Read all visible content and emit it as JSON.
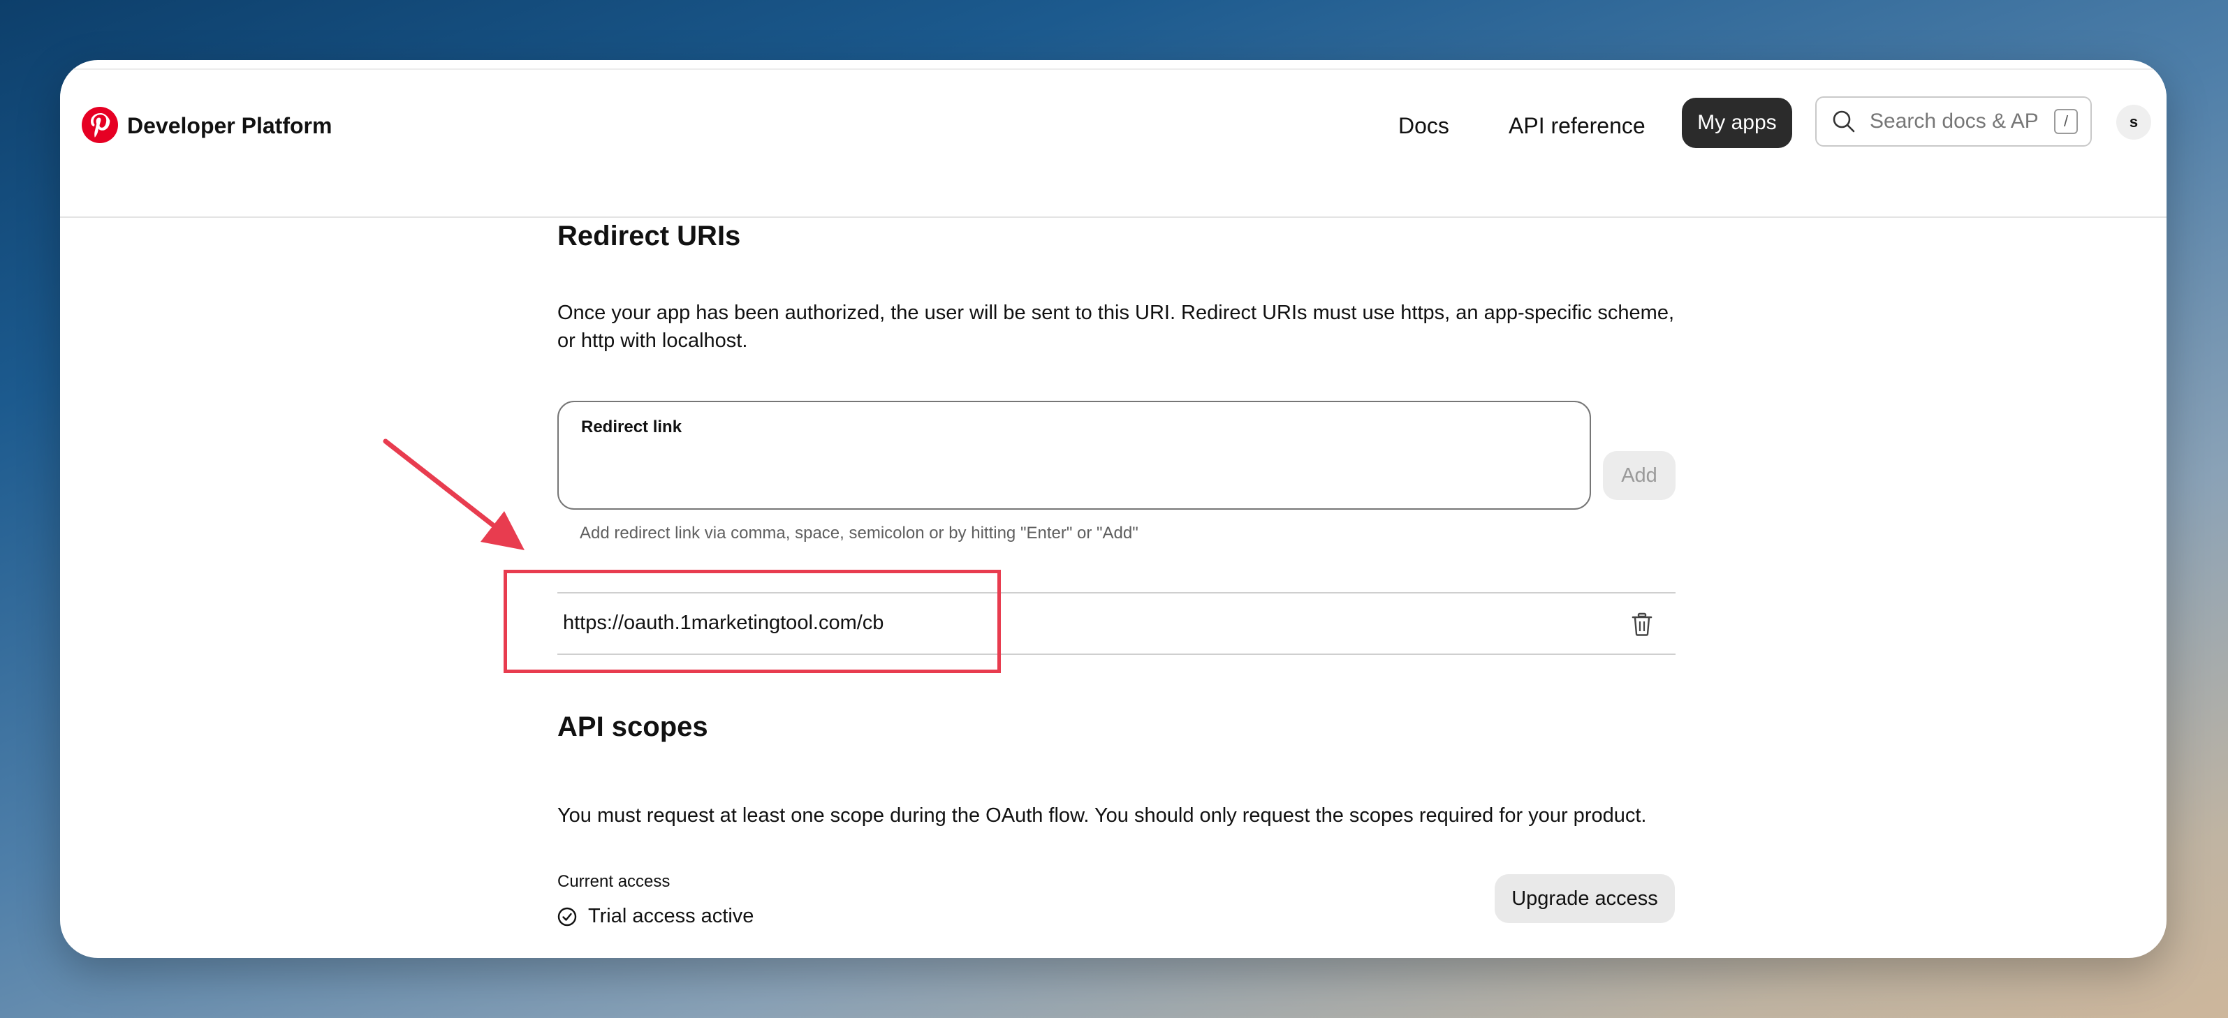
{
  "header": {
    "brand": "Developer Platform",
    "nav": {
      "docs": "Docs",
      "api_reference": "API reference",
      "my_apps": "My apps"
    },
    "search": {
      "placeholder": "Search docs & API",
      "shortcut": "/"
    },
    "avatar_initial": "s",
    "brand_color": "#e60023"
  },
  "redirect": {
    "heading": "Redirect URIs",
    "description": "Once your app has been authorized, the user will be sent to this URI. Redirect URIs must use https, an app-specific scheme, or http with localhost.",
    "field_label": "Redirect link",
    "field_value": "",
    "add_label": "Add",
    "helper": "Add redirect link via comma, space, semicolon or by hitting \"Enter\" or \"Add\"",
    "uris": [
      "https://oauth.1marketingtool.com/cb"
    ],
    "annotation_color": "#e83c4f"
  },
  "scopes": {
    "heading": "API scopes",
    "description": "You must request at least one scope during the OAuth flow. You should only request the scopes required for your product.",
    "current_access_label": "Current access",
    "status": "Trial access active",
    "upgrade_label": "Upgrade access"
  },
  "icons": [
    "pinterest-logo-icon",
    "search-icon",
    "trash-icon",
    "check-circle-icon",
    "annotation-arrow-icon"
  ]
}
